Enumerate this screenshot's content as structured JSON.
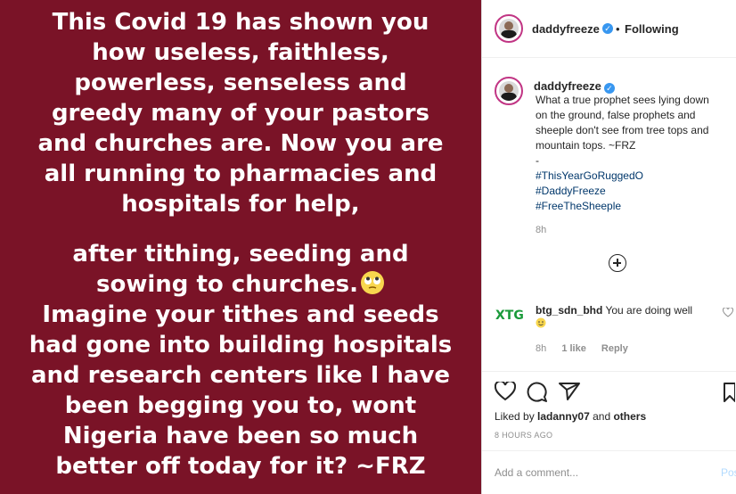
{
  "image_text": {
    "block1": [
      "This Covid 19 has shown you",
      "how useless, faithless,",
      "powerless, senseless and",
      "greedy many of your pastors",
      "and churches are. Now you are",
      "all running to pharmacies and",
      "hospitals for help,"
    ],
    "block2_first": "after tithing, seeding and",
    "block2_emoji_line": "sowing to churches.",
    "block2_rest": [
      "Imagine your tithes and seeds",
      "had gone into building hospitals",
      "and research centers like I have",
      "been begging you to, wont",
      "Nigeria have been so much",
      "better off today for it? ~FRZ"
    ],
    "emoji_icon": "face-with-rolling-eyes-icon"
  },
  "header": {
    "username": "daddyfreeze",
    "verified_icon": "verified-badge-icon",
    "separator": "•",
    "follow_status": "Following"
  },
  "caption": {
    "username": "daddyfreeze",
    "lines": [
      "What a true prophet sees lying down",
      "on the ground, false prophets and",
      "sheeple don't see from tree tops and",
      "mountain tops. ~FRZ",
      "-"
    ],
    "hashtags": [
      "#ThisYearGoRuggedO",
      "#DaddyFreeze",
      "#FreeTheSheeple"
    ],
    "time": "8h"
  },
  "comment": {
    "username": "btg_sdn_bhd",
    "text": "You are doing well",
    "avatar_label": "XTG",
    "time": "8h",
    "likes": "1 like",
    "reply": "Reply"
  },
  "footer": {
    "liked_prefix": "Liked by",
    "liked_user": "ladanny07",
    "liked_and": "and",
    "liked_others": "others",
    "timestamp": "8 HOURS AGO",
    "add_comment_placeholder": "Add a comment...",
    "post_label": "Pos"
  },
  "colors": {
    "post_background": "#7a1327",
    "verified": "#3897f0",
    "hashtag": "#00376b",
    "muted": "#8e8e8e"
  }
}
